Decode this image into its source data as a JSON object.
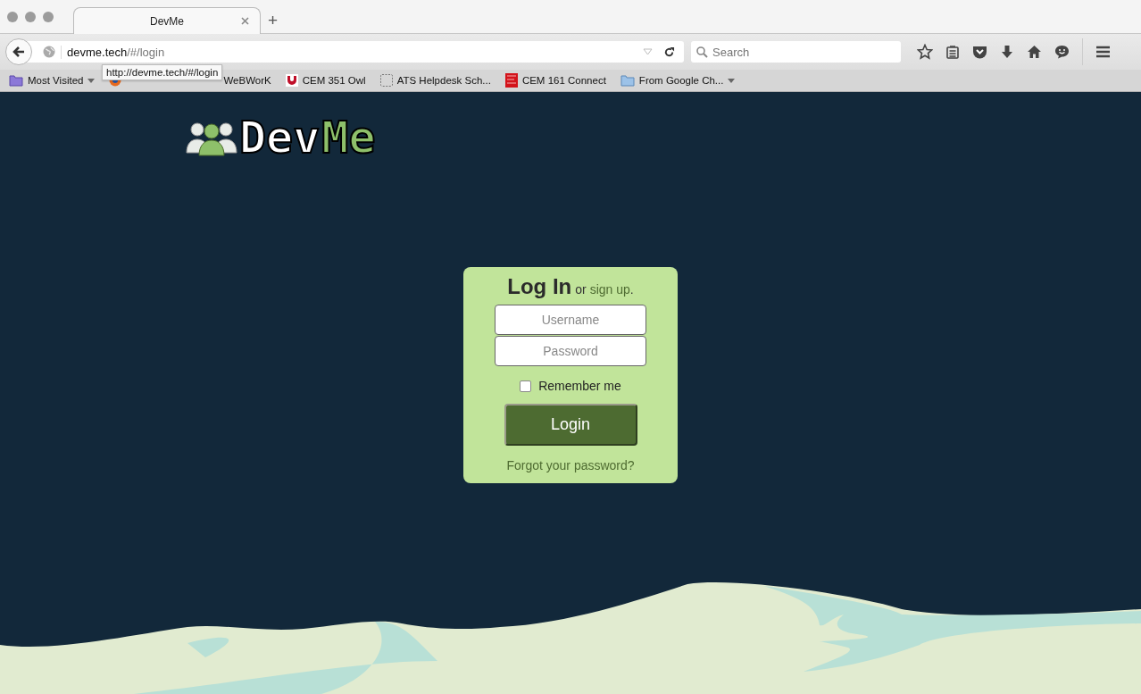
{
  "window": {
    "tab_title": "DevMe",
    "new_tab": "+"
  },
  "address_bar": {
    "url_host": "devme.tech",
    "url_path": "/#/login",
    "tooltip": "http://devme.tech/#/login"
  },
  "search": {
    "placeholder": "Search"
  },
  "bookmarks": [
    {
      "label": "Most Visited",
      "kind": "smart-folder",
      "dropdown": true
    },
    {
      "kind": "browser",
      "dropdown": false
    },
    {
      "label": "WeBWorK",
      "kind": "none",
      "dropdown": false
    },
    {
      "label": "CEM 351 Owl",
      "kind": "shield",
      "dropdown": false
    },
    {
      "label": "ATS Helpdesk Sch...",
      "kind": "blank",
      "dropdown": false
    },
    {
      "label": "CEM 161 Connect",
      "kind": "publisher",
      "dropdown": false
    },
    {
      "label": "From Google Ch...",
      "kind": "folder",
      "dropdown": true
    }
  ],
  "logo": {
    "part_1": "Dev",
    "part_2": "Me"
  },
  "login": {
    "title": "Log In",
    "or_text": "or",
    "signup_link": "sign up",
    "period": ".",
    "username_placeholder": "Username",
    "password_placeholder": "Password",
    "remember_label": "Remember me",
    "remember_checked": false,
    "button": "Login",
    "forgot_link": "Forgot your password?"
  }
}
